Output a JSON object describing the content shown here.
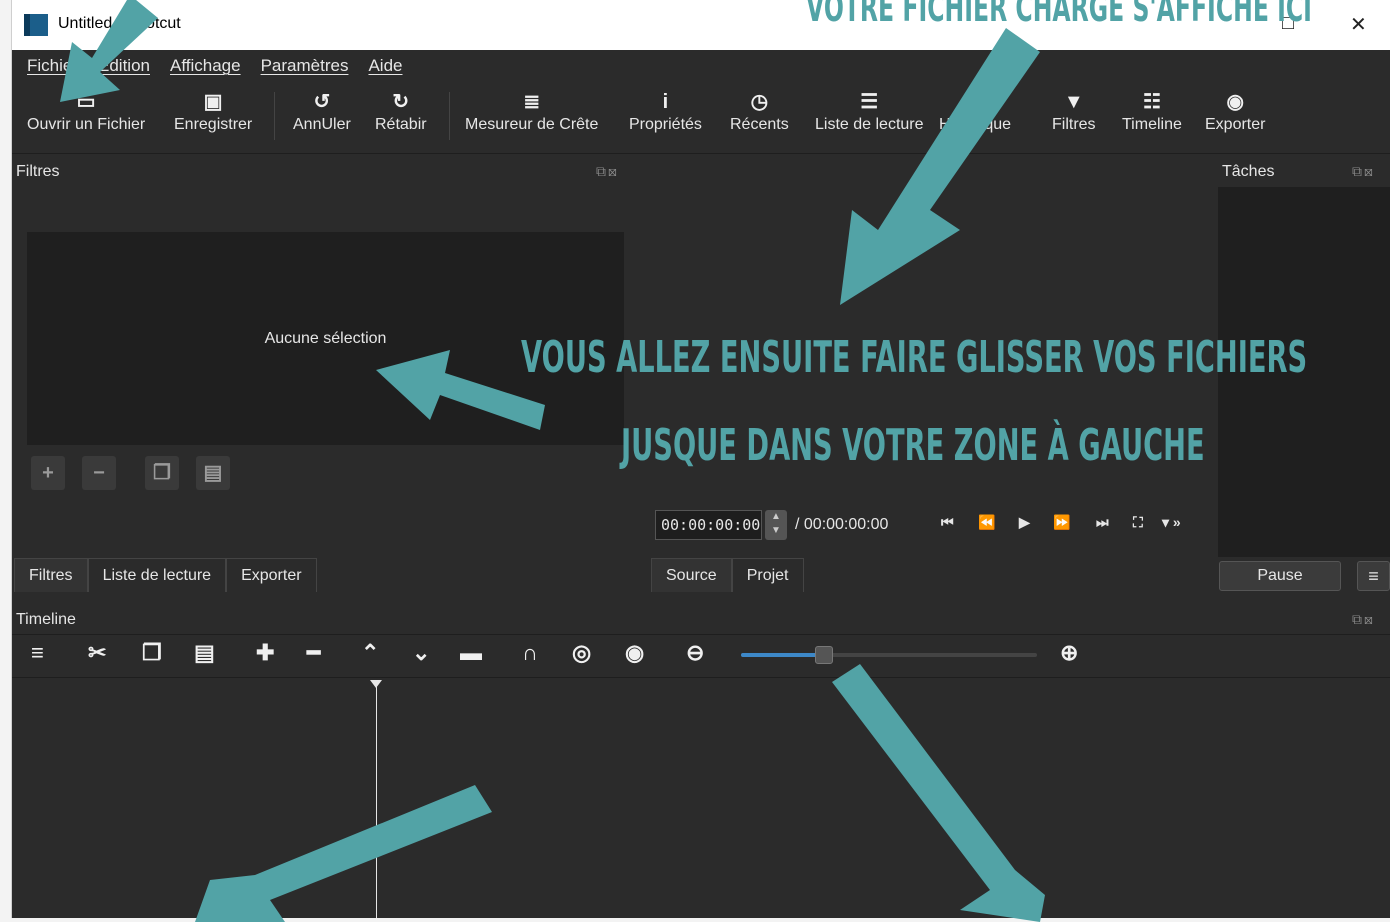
{
  "window": {
    "title": "Untitled - Shotcut",
    "title_visible": "Untitled - Shotcut"
  },
  "menu": [
    "Fichier",
    "Édition",
    "Affichage",
    "Paramètres",
    "Aide"
  ],
  "toolbar": [
    {
      "label": "Ouvrir un Fichier",
      "icon": "folder-open-icon"
    },
    {
      "label": "Enregistrer",
      "icon": "save-icon"
    },
    {
      "label": "AnnUler",
      "icon": "undo-icon"
    },
    {
      "label": "Rétabir",
      "icon": "redo-icon"
    },
    {
      "label": "Mesureur de Crête",
      "icon": "peak-meter-icon"
    },
    {
      "label": "Propriétés",
      "icon": "info-icon"
    },
    {
      "label": "Récents",
      "icon": "clock-icon"
    },
    {
      "label": "Liste de lecture",
      "icon": "list-icon"
    },
    {
      "label": "Historique",
      "icon": "history-icon"
    },
    {
      "label": "Filtres",
      "icon": "filter-icon"
    },
    {
      "label": "Timeline",
      "icon": "timeline-icon"
    },
    {
      "label": "Exporter",
      "icon": "export-icon"
    }
  ],
  "filters_panel": {
    "title": "Filtres",
    "empty_text": "Aucune sélection",
    "tabs": [
      "Filtres",
      "Liste de lecture",
      "Exporter"
    ]
  },
  "player": {
    "timecode": "00:00:00:00",
    "duration": "/ 00:00:00:00",
    "tabs": [
      "Source",
      "Projet"
    ]
  },
  "tasks_panel": {
    "title": "Tâches",
    "pause_label": "Pause"
  },
  "timeline": {
    "title": "Timeline",
    "zoom_level": 0.27
  },
  "annotations": {
    "top": "VOTRE FICHIER CHARGÉ S'AFFICHE ICI",
    "line1": "VOUS ALLEZ ENSUITE FAIRE GLISSER VOS FICHIERS",
    "line2": "JUSQUE DANS VOTRE ZONE À GAUCHE",
    "color": "#52a3a6"
  }
}
